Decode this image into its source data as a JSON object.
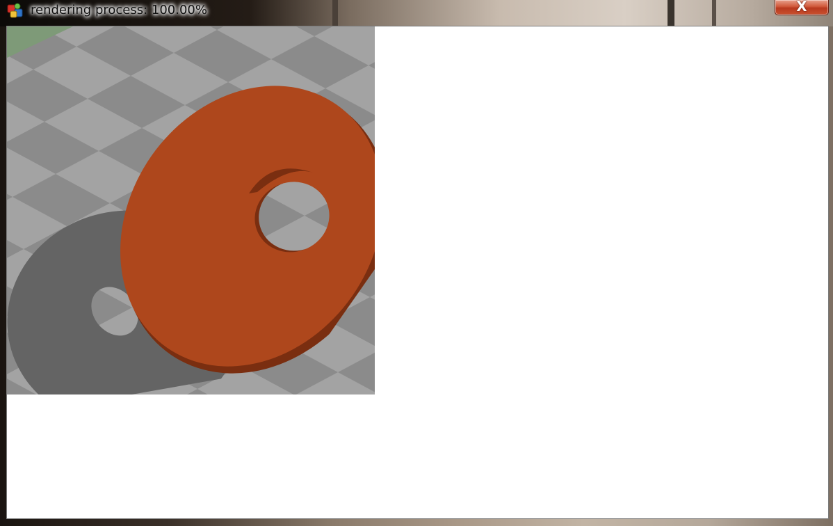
{
  "window": {
    "title": "rendering process: 100.00%",
    "close_label": "X",
    "app_icon": "render-app-icon",
    "close_icon": "close-icon"
  },
  "render": {
    "progress_percent": 100.0,
    "scene": {
      "floor": "gray-checkerboard-plane",
      "object": "orange-washer-disk",
      "shadow": "washer-shadow"
    },
    "colors": {
      "floor_light": "#a4a4a4",
      "floor_dark": "#8c8c8c",
      "washer": "#ae471c",
      "washer_edge": "#7a2e10",
      "shadow": "#646464",
      "corner_tint": "#7e9a78"
    }
  }
}
